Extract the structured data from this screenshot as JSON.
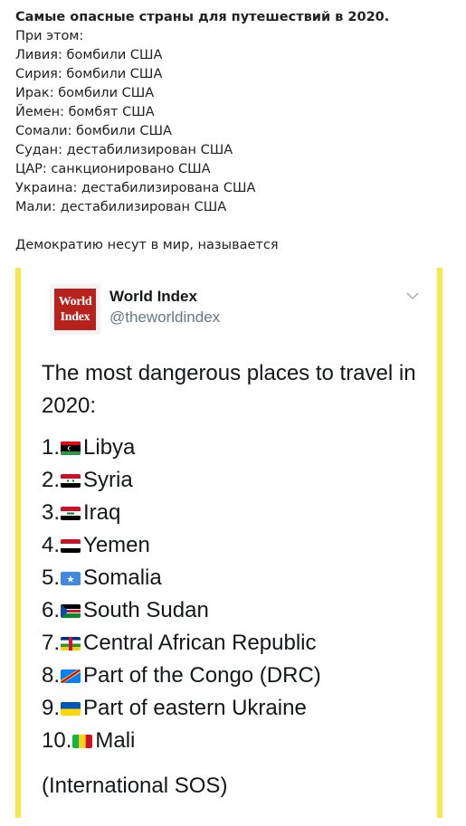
{
  "post": {
    "title": "Самые опасные страны для путешествий в 2020.",
    "intro": "При этом:",
    "lines": [
      "Ливия: бомбили США",
      "Сирия: бомбили США",
      "Ирак: бомбили США",
      "Йемен: бомбят США",
      "Сомали: бомбили США",
      "Судан: дестабилизирован США",
      "ЦАР: санкционировано США",
      "Украина: дестабилизирована США",
      "Мали: дестабилизирован США"
    ],
    "footer": "Демократию несут в мир, называется"
  },
  "tweet": {
    "logo_line1": "World",
    "logo_line2": "Index",
    "account_name": "World Index",
    "handle": "@theworldindex",
    "caret_icon": "chevron-down-icon",
    "intro": "The most dangerous places to travel in 2020:",
    "items": [
      {
        "rank": "1.",
        "country": "Libya",
        "flag": "libya"
      },
      {
        "rank": "2.",
        "country": "Syria",
        "flag": "syria"
      },
      {
        "rank": "3.",
        "country": "Iraq",
        "flag": "iraq"
      },
      {
        "rank": "4.",
        "country": "Yemen",
        "flag": "yemen"
      },
      {
        "rank": "5.",
        "country": "Somalia",
        "flag": "somalia"
      },
      {
        "rank": "6.",
        "country": "South Sudan",
        "flag": "south-sudan"
      },
      {
        "rank": "7.",
        "country": "Central African Republic",
        "flag": "car"
      },
      {
        "rank": "8.",
        "country": "Part of the Congo (DRC)",
        "flag": "drc"
      },
      {
        "rank": "9.",
        "country": "Part of eastern Ukraine",
        "flag": "ukraine"
      },
      {
        "rank": "10.",
        "country": "Mali",
        "flag": "mali"
      }
    ],
    "source": "(International SOS)"
  },
  "colors": {
    "border_accent": "#f6e84a",
    "logo_red": "#b8221c",
    "handle_grey": "#657786"
  }
}
